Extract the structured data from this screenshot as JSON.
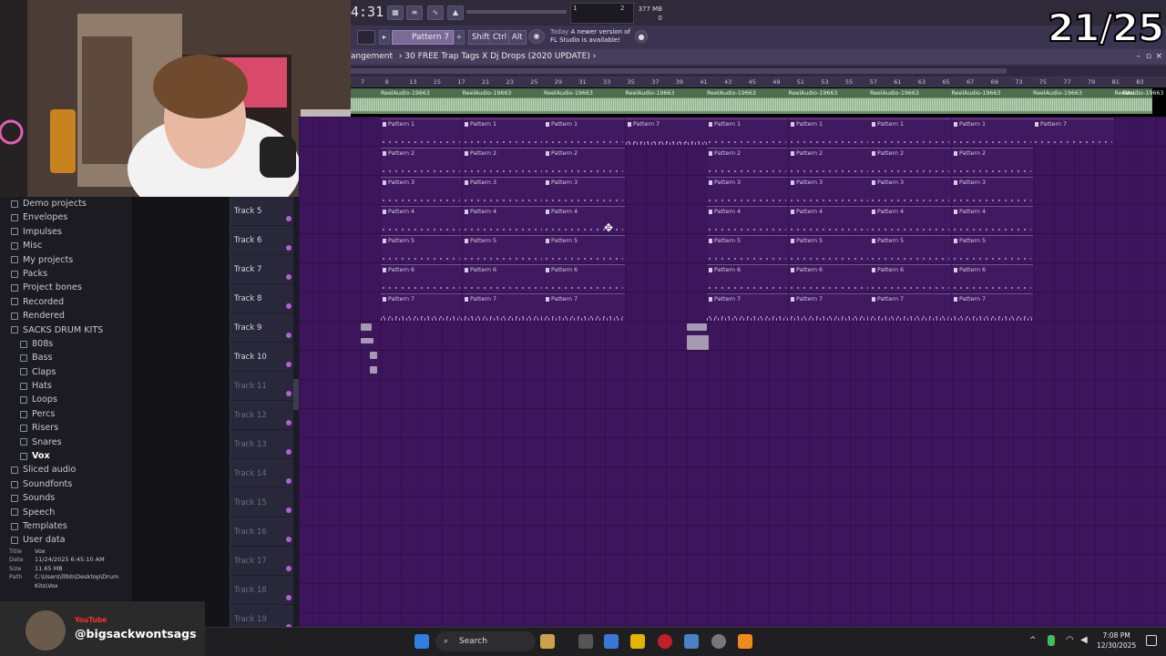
{
  "counter": "21/25",
  "clock": "4:31",
  "monitor": {
    "bars": "1",
    "steps": "2"
  },
  "memory": {
    "value": "377 MB",
    "sub": "0"
  },
  "pattern_selector": "Pattern 7",
  "modifiers": [
    "Shift",
    "Ctrl",
    "Alt"
  ],
  "news": {
    "today": "Today",
    "line1": "A newer version of",
    "line2": "FL Studio is available!"
  },
  "window_title": "angement",
  "breadcrumb": "30 FREE Trap Tags X Dj Drops (2020 UPDATE)",
  "ruler": [
    "7",
    "9",
    "13",
    "15",
    "17",
    "21",
    "23",
    "25",
    "29",
    "31",
    "33",
    "35",
    "37",
    "39",
    "41",
    "43",
    "45",
    "49",
    "51",
    "53",
    "55",
    "57",
    "61",
    "63",
    "65",
    "67",
    "69",
    "73",
    "75",
    "77",
    "79",
    "81",
    "83"
  ],
  "audio_clip_label": "ReelAudio-19663",
  "audio_clip_label_last": "Reel...",
  "browser": {
    "items": [
      {
        "label": "Demo projects",
        "icon": "folder-icon"
      },
      {
        "label": "Envelopes",
        "icon": "folder-icon"
      },
      {
        "label": "Impulses",
        "icon": "folder-icon"
      },
      {
        "label": "Misc",
        "icon": "folder-icon"
      },
      {
        "label": "My projects",
        "icon": "folder-icon"
      },
      {
        "label": "Packs",
        "icon": "folder-icon"
      },
      {
        "label": "Project bones",
        "icon": "folder-icon"
      },
      {
        "label": "Recorded",
        "icon": "plus-icon"
      },
      {
        "label": "Rendered",
        "icon": "folder-icon"
      },
      {
        "label": "SACKS DRUM KITS",
        "icon": "folder-icon"
      },
      {
        "label": "808s",
        "icon": "folder-icon",
        "sub": true
      },
      {
        "label": "Bass",
        "icon": "folder-icon",
        "sub": true
      },
      {
        "label": "Claps",
        "icon": "folder-icon",
        "sub": true
      },
      {
        "label": "Hats",
        "icon": "folder-icon",
        "sub": true
      },
      {
        "label": "Loops",
        "icon": "folder-icon",
        "sub": true
      },
      {
        "label": "Percs",
        "icon": "folder-icon",
        "sub": true
      },
      {
        "label": "Risers",
        "icon": "folder-icon",
        "sub": true
      },
      {
        "label": "Snares",
        "icon": "folder-icon",
        "sub": true
      },
      {
        "label": "Vox",
        "icon": "folder-icon",
        "sub": true,
        "selected": true
      },
      {
        "label": "Sliced audio",
        "icon": "plus-icon"
      },
      {
        "label": "Soundfonts",
        "icon": "folder-icon"
      },
      {
        "label": "Sounds",
        "icon": "cloud-icon"
      },
      {
        "label": "Speech",
        "icon": "folder-icon"
      },
      {
        "label": "Templates",
        "icon": "folder-icon"
      },
      {
        "label": "User data",
        "icon": "user-icon"
      }
    ],
    "fileinfo": [
      {
        "k": "Title",
        "v": "Vox"
      },
      {
        "k": "Date",
        "v": "11/24/2025 6:45:10 AM"
      },
      {
        "k": "Size",
        "v": "11.65 MB"
      },
      {
        "k": "Path",
        "v": "C:\\Users\\lllbb\\Desktop\\Drum"
      },
      {
        "k": "",
        "v": "Kits\\Vox"
      }
    ]
  },
  "tracks": [
    {
      "label": "Track 5",
      "dim": false
    },
    {
      "label": "Track 6",
      "dim": false
    },
    {
      "label": "Track 7",
      "dim": false
    },
    {
      "label": "Track 8",
      "dim": false
    },
    {
      "label": "Track 9",
      "dim": false
    },
    {
      "label": "Track 10",
      "dim": false
    },
    {
      "label": "Track 11",
      "dim": true
    },
    {
      "label": "Track 12",
      "dim": true
    },
    {
      "label": "Track 13",
      "dim": true
    },
    {
      "label": "Track 14",
      "dim": true
    },
    {
      "label": "Track 15",
      "dim": true
    },
    {
      "label": "Track 16",
      "dim": true
    },
    {
      "label": "Track 17",
      "dim": true
    },
    {
      "label": "Track 18",
      "dim": true
    },
    {
      "label": "Track 19",
      "dim": true
    }
  ],
  "patterns": [
    "Pattern 1",
    "Pattern 2",
    "Pattern 3",
    "Pattern 4",
    "Pattern 5",
    "Pattern 6",
    "Pattern 7"
  ],
  "youtube": {
    "label": "YouTube",
    "handle": "@bigsackwontsags"
  },
  "taskbar": {
    "search": "Search",
    "time": "7:08 PM",
    "date": "12/30/2025"
  }
}
